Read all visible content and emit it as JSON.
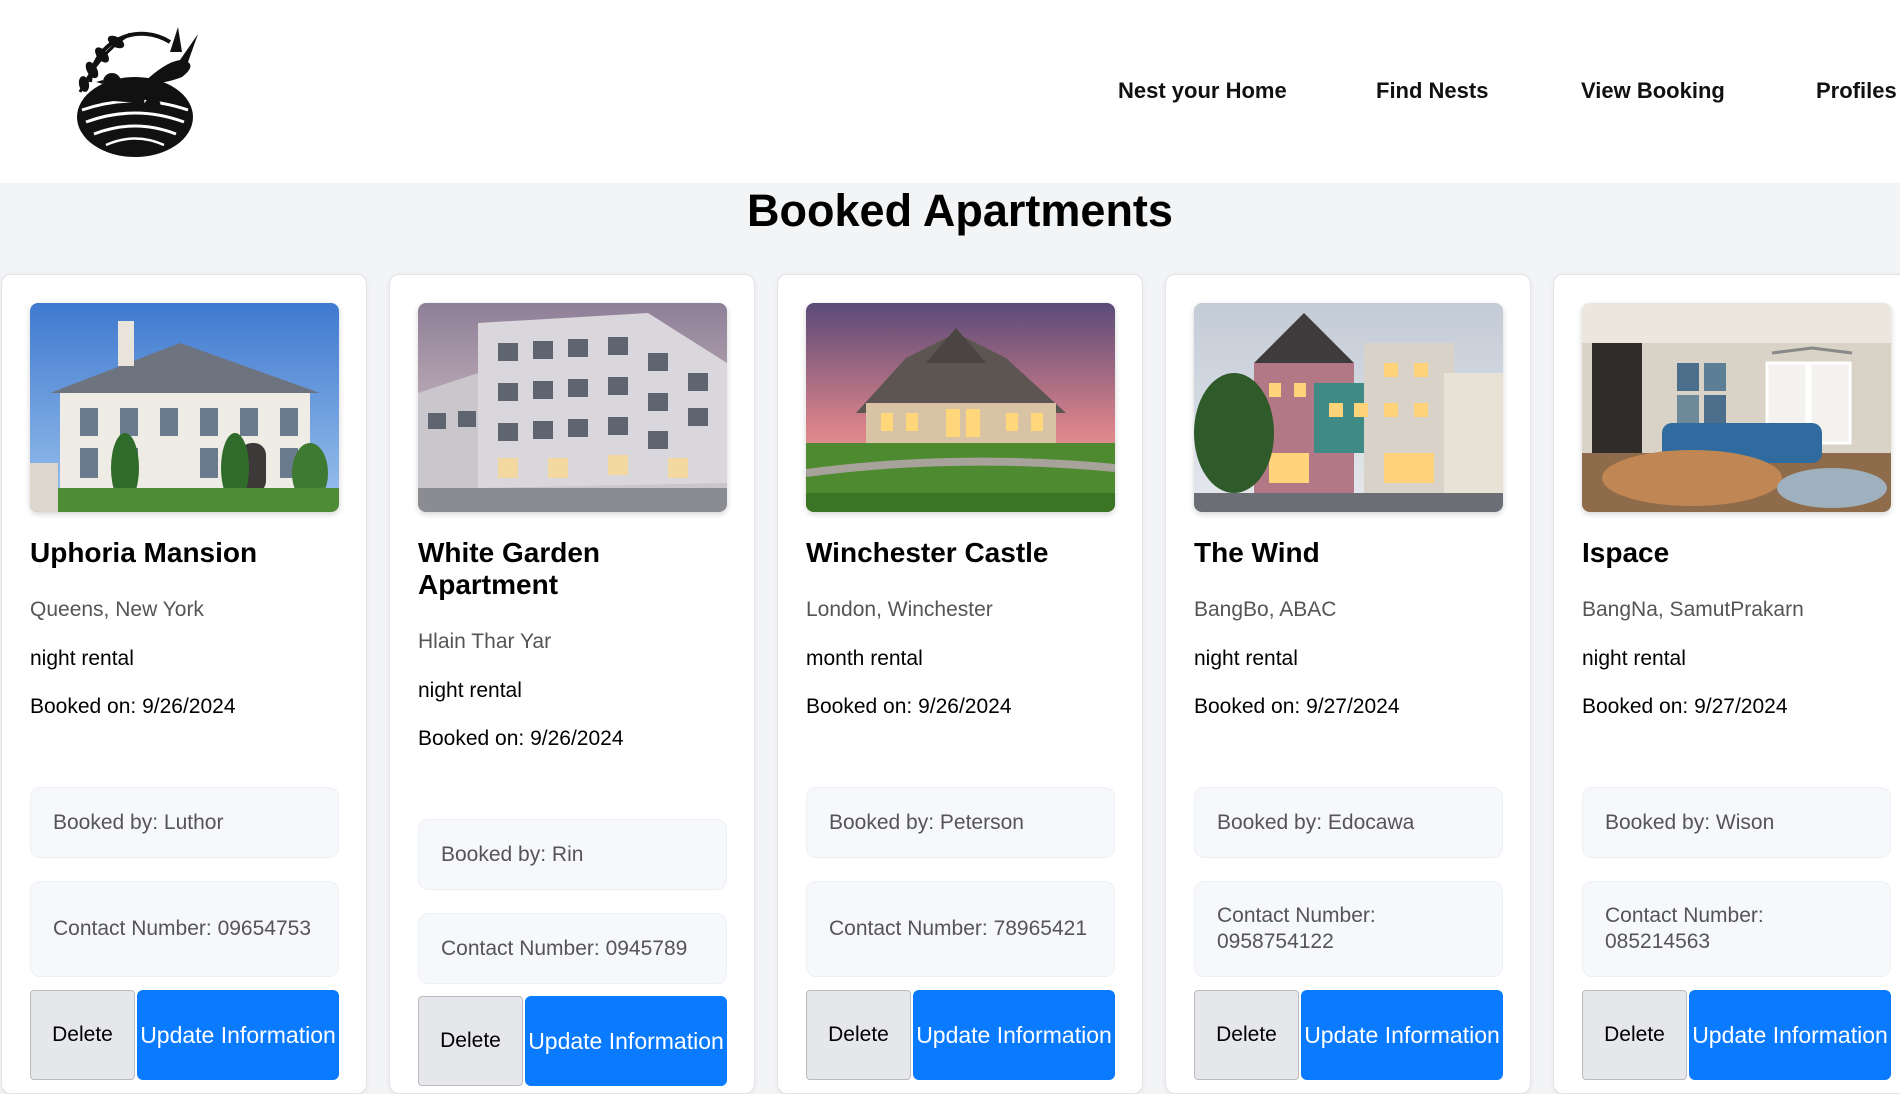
{
  "nav": {
    "items": [
      "Nest your Home",
      "Find Nests",
      "View Booking",
      "Profiles"
    ]
  },
  "page": {
    "title": "Booked Apartments"
  },
  "colors": {
    "primary_button": "#0a7bff",
    "background": "#f3f4f6"
  },
  "cards": [
    {
      "name": "Uphoria Mansion",
      "location": "Queens, New York",
      "rental": "night rental",
      "booked_on": "Booked on: 9/26/2024",
      "booked_by": "Booked by: Luthor",
      "contact": "Contact Number: 09654753",
      "delete_label": "Delete",
      "update_label": "Update Information"
    },
    {
      "name": "White Garden Apartment",
      "location": "Hlain Thar Yar",
      "rental": "night rental",
      "booked_on": "Booked on: 9/26/2024",
      "booked_by": "Booked by: Rin",
      "contact": "Contact Number: 0945789",
      "delete_label": "Delete",
      "update_label": "Update Information"
    },
    {
      "name": "Winchester Castle",
      "location": "London, Winchester",
      "rental": "month rental",
      "booked_on": "Booked on: 9/26/2024",
      "booked_by": "Booked by: Peterson",
      "contact": "Contact Number: 78965421",
      "delete_label": "Delete",
      "update_label": "Update Information"
    },
    {
      "name": "The Wind",
      "location": "BangBo, ABAC",
      "rental": "night rental",
      "booked_on": "Booked on: 9/27/2024",
      "booked_by": "Booked by: Edocawa",
      "contact": "Contact Number: 0958754122",
      "delete_label": "Delete",
      "update_label": "Update Information"
    },
    {
      "name": "Ispace",
      "location": "BangNa, SamutPrakarn",
      "rental": "night rental",
      "booked_on": "Booked on: 9/27/2024",
      "booked_by": "Booked by: Wison",
      "contact": "Contact Number: 085214563",
      "delete_label": "Delete",
      "update_label": "Update Information"
    }
  ]
}
